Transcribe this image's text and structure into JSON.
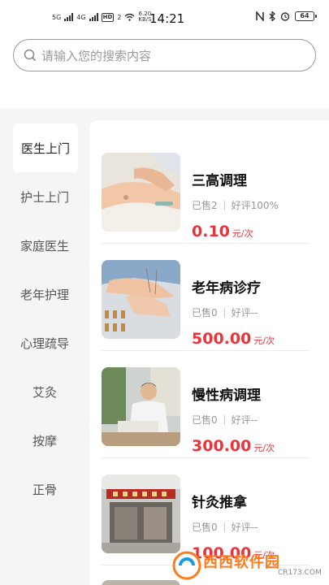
{
  "status_bar": {
    "sig1": "5G",
    "sig2": "4G",
    "hd": "HD",
    "hd_num": "2",
    "net_speed": "6.20",
    "net_unit": "KB/S",
    "time": "14:21",
    "battery": "64"
  },
  "search": {
    "placeholder": "请输入您的搜索内容"
  },
  "sidebar": {
    "items": [
      {
        "label": "医生上门"
      },
      {
        "label": "护士上门"
      },
      {
        "label": "家庭医生"
      },
      {
        "label": "老年护理"
      },
      {
        "label": "心理疏导"
      },
      {
        "label": "艾灸"
      },
      {
        "label": "按摩"
      },
      {
        "label": "正骨"
      }
    ],
    "active_index": 0
  },
  "services": [
    {
      "title": "三高调理",
      "sold": "已售2",
      "rating": "好评100%",
      "price": "0.10",
      "unit": "元/次",
      "image": "pulse-check-photo"
    },
    {
      "title": "老年病诊疗",
      "sold": "已售0",
      "rating": "好评--",
      "price": "500.00",
      "unit": "元/次",
      "image": "acupuncture-photo"
    },
    {
      "title": "慢性病调理",
      "sold": "已售0",
      "rating": "好评--",
      "price": "300.00",
      "unit": "元/次",
      "image": "doctor-reading-photo"
    },
    {
      "title": "针灸推拿",
      "sold": "已售0",
      "rating": "好评--",
      "price": "100.00",
      "unit": "元/次",
      "image": "clinic-storefront-photo"
    }
  ],
  "watermark": {
    "text": "西西软件园",
    "url": "CR173.COM"
  },
  "colors": {
    "price": "#e8343a",
    "background": "#f5f5f5",
    "accent_watermark": "#ff7a1a"
  }
}
